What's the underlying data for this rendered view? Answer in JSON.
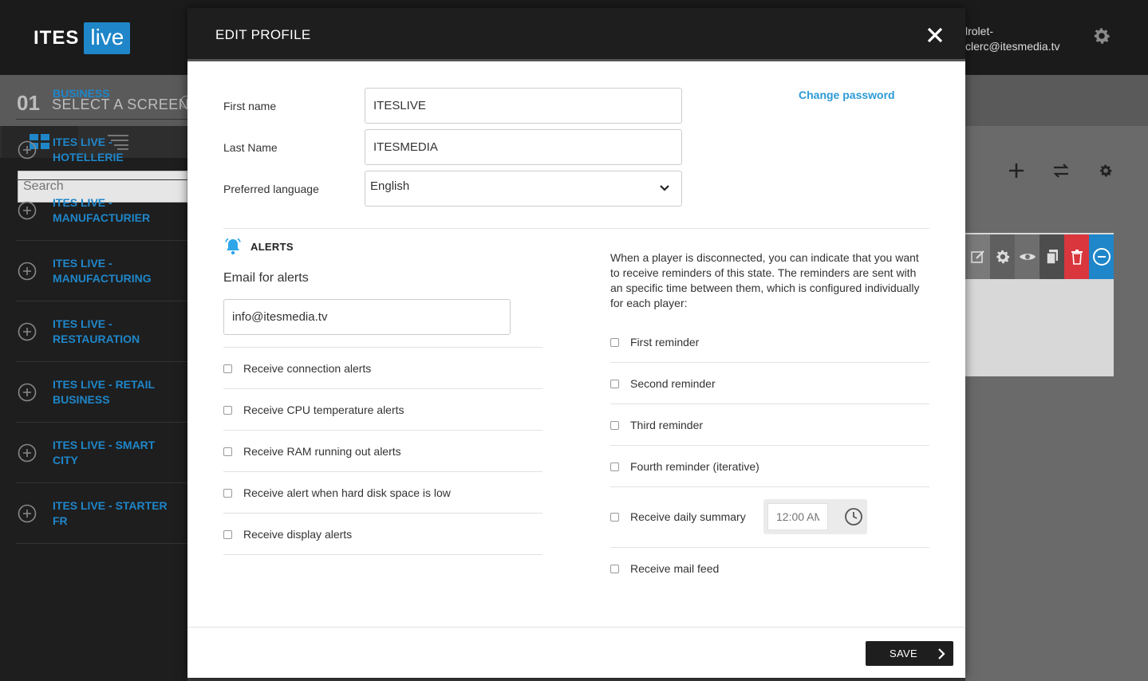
{
  "app": {
    "logo_ites": "ITES",
    "logo_live": "live",
    "user_line1": "lrolet-",
    "user_line2": "clerc@itesmedia.tv",
    "step_number": "01",
    "step_label": "SELECT A SCREEN",
    "search_placeholder": "Search",
    "categories": [
      "BUSINESS",
      "ITES LIVE - HOTELLERIE",
      "ITES LIVE - MANUFACTURIER",
      "ITES LIVE - MANUFACTURING",
      "ITES LIVE - RESTAURATION",
      "ITES LIVE - RETAIL BUSINESS",
      "ITES LIVE - SMART CITY",
      "ITES LIVE - STARTER FR"
    ]
  },
  "modal": {
    "title": "EDIT PROFILE",
    "first_name_label": "First name",
    "first_name_value": "ITESLIVE",
    "last_name_label": "Last Name",
    "last_name_value": "ITESMEDIA",
    "language_label": "Preferred language",
    "language_value": "English",
    "change_password": "Change password",
    "alerts_title": "ALERTS",
    "email_label": "Email for alerts",
    "email_value": "info@itesmedia.tv",
    "left_checks": [
      "Receive connection alerts",
      "Receive CPU temperature alerts",
      "Receive RAM running out alerts",
      "Receive alert when hard disk space is low",
      "Receive display alerts"
    ],
    "reminder_description": "When a player is disconnected, you can indicate that you want to receive reminders of this state. The reminders are sent with an specific time between them, which is configured individually for each player:",
    "right_checks": [
      "First reminder",
      "Second reminder",
      "Third reminder",
      "Fourth reminder (iterative)"
    ],
    "daily_summary_label": "Receive daily summary",
    "daily_summary_time": "12:00 AM",
    "mail_feed_label": "Receive mail feed",
    "save_label": "SAVE"
  },
  "colors": {
    "brand_blue": "#1f86c9",
    "link_blue": "#2c9ad6",
    "bell_blue": "#2fa6e8",
    "danger_red": "#d9363e"
  },
  "icons": [
    "gear-icon",
    "grid-icon",
    "filter-list-icon",
    "plus-circle-icon",
    "plus-icon",
    "swap-icon",
    "edit-icon",
    "eye-icon",
    "copy-icon",
    "trash-icon",
    "minus-circle-icon",
    "close-icon",
    "chevron-down-icon",
    "bell-icon",
    "clock-icon",
    "chevron-right-icon"
  ]
}
